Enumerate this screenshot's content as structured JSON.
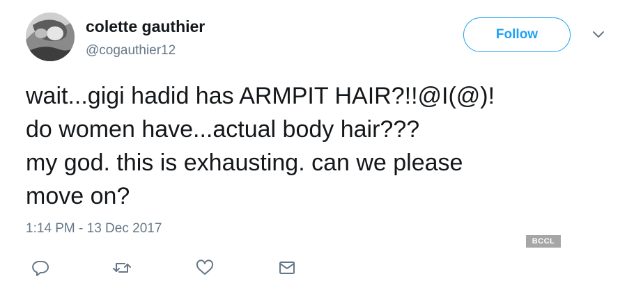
{
  "user": {
    "display_name": "colette gauthier",
    "handle": "@cogauthier12",
    "avatar_icon": "profile-photo"
  },
  "follow_button": {
    "label": "Follow"
  },
  "menu": {
    "icon": "chevron-down-icon"
  },
  "tweet": {
    "lines": [
      "wait...gigi hadid has ARMPIT HAIR?!!@I(@)!",
      "do women have...actual body hair???",
      "my god. this is exhausting. can we please",
      "move on?"
    ],
    "timestamp": "1:14 PM - 13 Dec 2017"
  },
  "watermark": {
    "text": "BCCL"
  },
  "actions": {
    "icons": [
      "reply-icon",
      "retweet-icon",
      "like-icon",
      "direct-message-icon"
    ]
  },
  "colors": {
    "accent": "#1da1f2",
    "text": "#14171a",
    "secondary_text": "#657786",
    "action_icon": "#657786"
  }
}
